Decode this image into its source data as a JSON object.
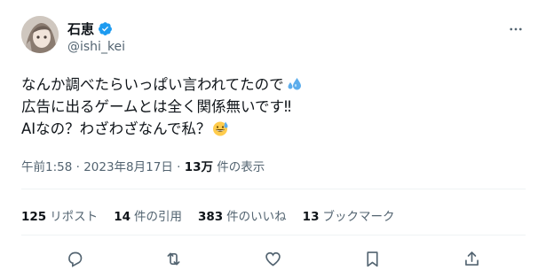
{
  "user": {
    "name": "石恵",
    "handle": "@ishi_kei"
  },
  "tweet": {
    "line1": "なんか調べたらいっぱい言われてたので",
    "line2": "広告に出るゲームとは全く関係無いです‼",
    "line3": "AIなの？わざわざなんで私？",
    "line1_emoji": "sweat-droplets-icon",
    "line3_emoji": "grinning-sweat-icon"
  },
  "meta": {
    "time": "午前1:58",
    "separator1": " · ",
    "date": "2023年8月17日",
    "separator2": " · ",
    "views": "13万",
    "views_label": " 件の表示"
  },
  "stats": {
    "retweets_count": "125",
    "retweets_label": "リポスト",
    "quotes_count": "14",
    "quotes_label": "件の引用",
    "likes_count": "383",
    "likes_label": "件のいいね",
    "bookmarks_count": "13",
    "bookmarks_label": "ブックマーク"
  },
  "colors": {
    "text": "#0f1419",
    "secondary": "#536471",
    "verified": "#1d9bf0",
    "divider": "#eff3f4"
  },
  "icons": {
    "more": "more-dots-icon",
    "reply": "reply-icon",
    "repost": "repost-icon",
    "like": "heart-icon",
    "bookmark": "bookmark-icon",
    "share": "share-icon"
  }
}
